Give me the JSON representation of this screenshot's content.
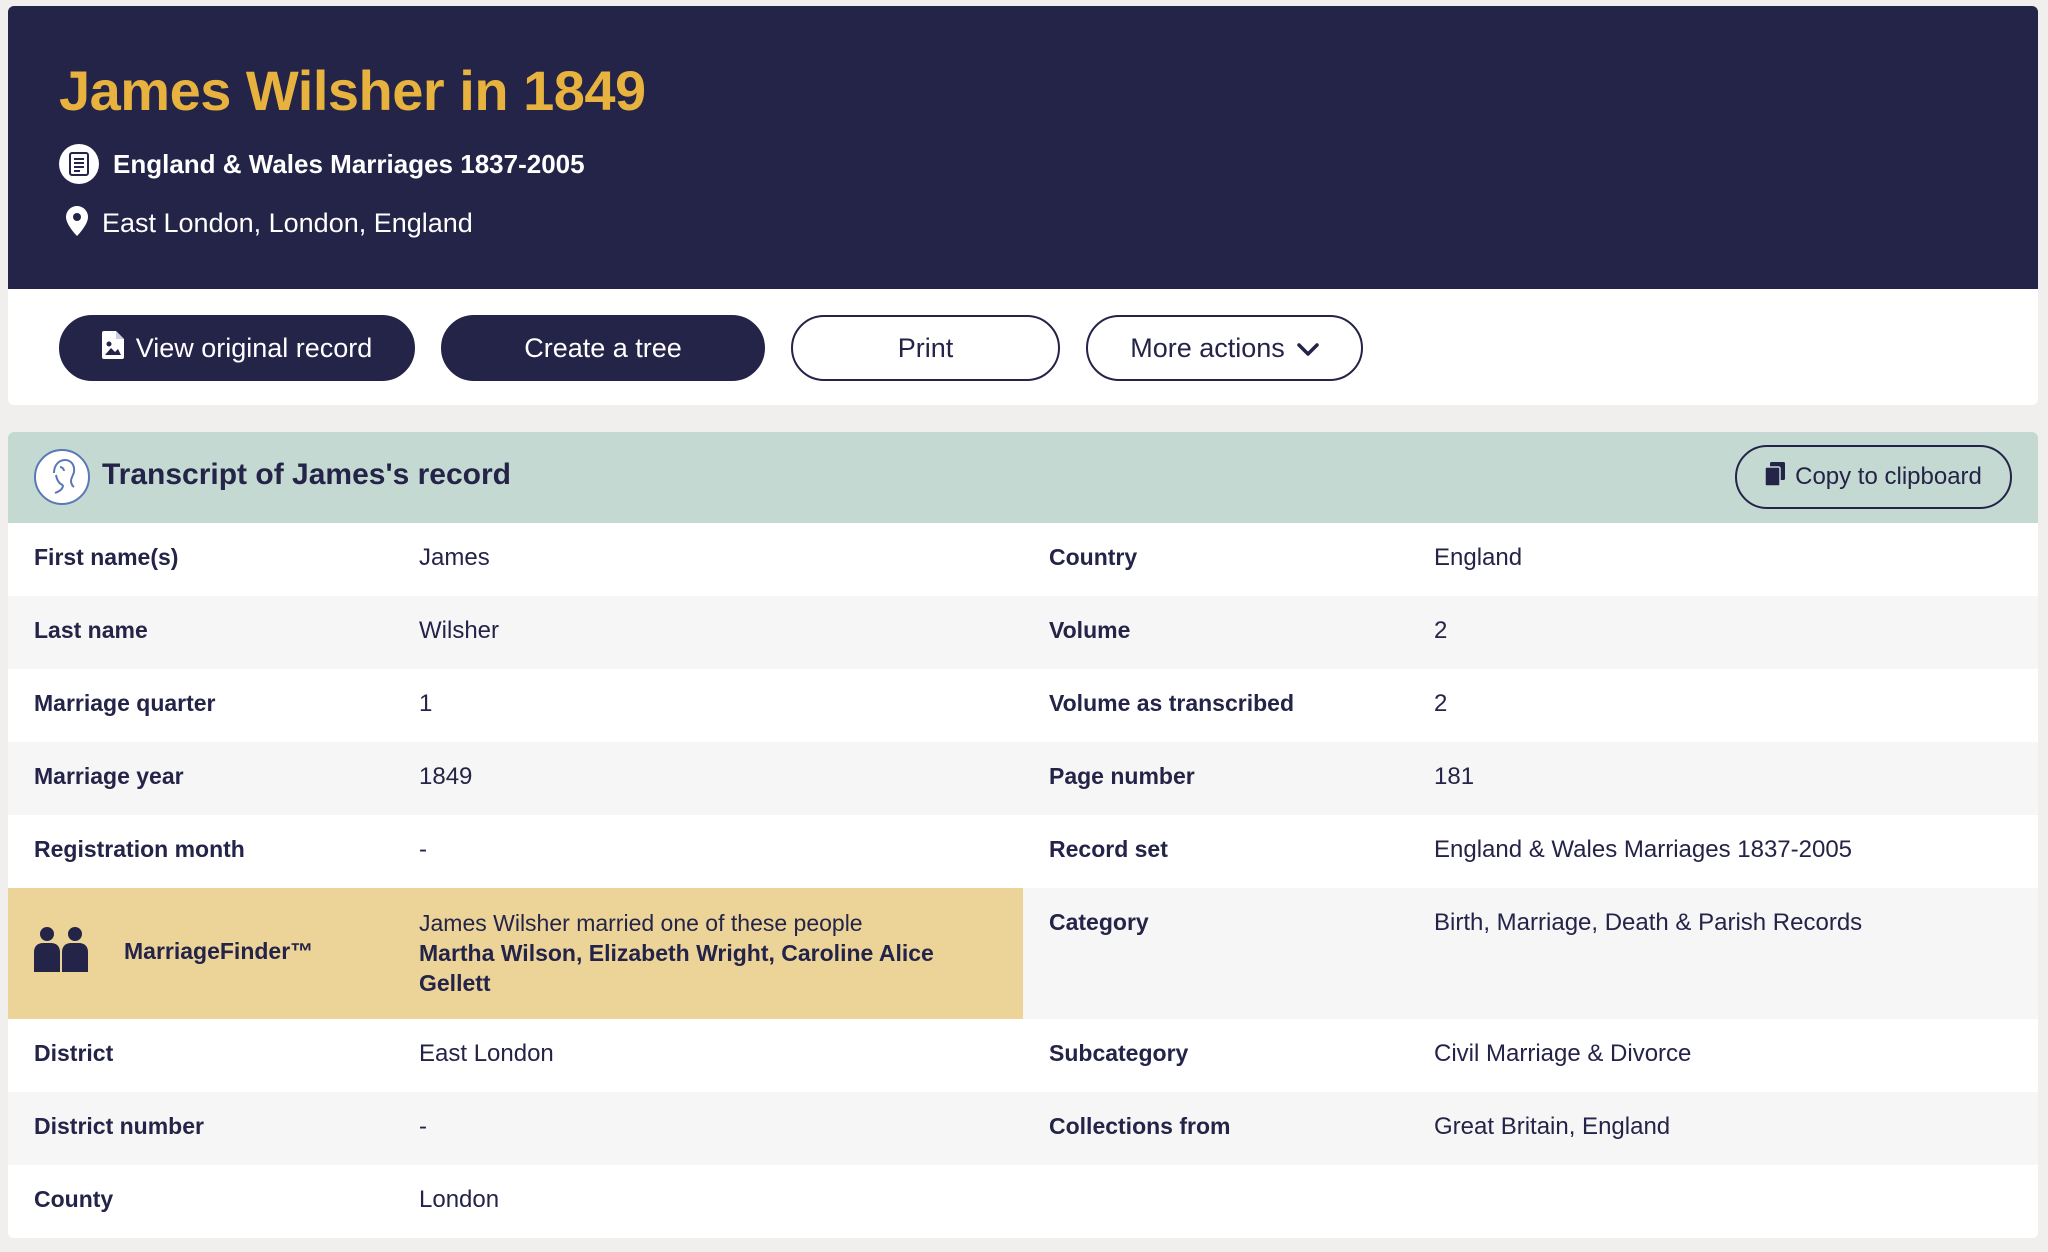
{
  "header": {
    "title": "James Wilsher in 1849",
    "collection": "England & Wales Marriages 1837-2005",
    "location": "East London, London, England",
    "background": "#242348",
    "title_color": "#e7b33e"
  },
  "actions": {
    "view_original": "View original record",
    "create_tree": "Create a tree",
    "print": "Print",
    "more_actions": "More actions"
  },
  "transcript": {
    "title": "Transcript of James's record",
    "copy_label": "Copy to clipboard",
    "rows": [
      {
        "left_label": "First name(s)",
        "left_value": "James",
        "right_label": "Country",
        "right_value": "England"
      },
      {
        "left_label": "Last name",
        "left_value": "Wilsher",
        "right_label": "Volume",
        "right_value": "2"
      },
      {
        "left_label": "Marriage quarter",
        "left_value": "1",
        "right_label": "Volume as transcribed",
        "right_value": "2"
      },
      {
        "left_label": "Marriage year",
        "left_value": "1849",
        "right_label": "Page number",
        "right_value": "181"
      },
      {
        "left_label": "Registration month",
        "left_value": "-",
        "right_label": "Record set",
        "right_value": "England & Wales Marriages 1837-2005"
      },
      {
        "right_label": "Category",
        "right_value": "Birth, Marriage, Death & Parish Records"
      },
      {
        "left_label": "District",
        "left_value": "East London",
        "right_label": "Subcategory",
        "right_value": "Civil Marriage & Divorce"
      },
      {
        "left_label": "District number",
        "left_value": "-",
        "right_label": "Collections from",
        "right_value": "Great Britain, England"
      },
      {
        "left_label": "County",
        "left_value": "London"
      }
    ],
    "marriage_finder": {
      "label": "MarriageFinder™",
      "intro": "James Wilsher married one of these people",
      "names": "Martha Wilson, Elizabeth Wright, Caroline Alice Gellett"
    }
  }
}
